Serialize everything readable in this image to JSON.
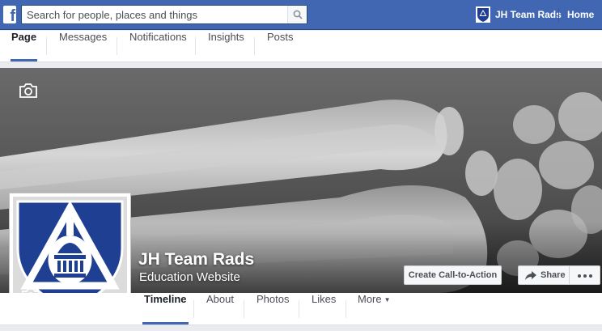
{
  "topbar": {
    "logo": "f",
    "search_placeholder": "Search for people, places and things",
    "page_name": "JH Team Rads",
    "home_label": "Home",
    "color": "#4267b2"
  },
  "admin_tabs": [
    {
      "label": "Page",
      "active": true
    },
    {
      "label": "Messages",
      "active": false
    },
    {
      "label": "Notifications",
      "active": false
    },
    {
      "label": "Insights",
      "active": false
    },
    {
      "label": "Posts",
      "active": false
    }
  ],
  "cover": {
    "page_title": "JH Team Rads",
    "page_category": "Education Website",
    "cta_label": "Create Call-to-Action",
    "share_label": "Share",
    "icons": [
      "camera-icon",
      "share-arrow-icon",
      "more-dots-icon"
    ]
  },
  "profile": {
    "logo_colors": {
      "shield": "#1f3f93",
      "border": "#ffffff"
    }
  },
  "timeline_tabs": [
    {
      "label": "Timeline",
      "active": true
    },
    {
      "label": "About",
      "active": false
    },
    {
      "label": "Photos",
      "active": false
    },
    {
      "label": "Likes",
      "active": false
    },
    {
      "label": "More",
      "active": false
    }
  ]
}
